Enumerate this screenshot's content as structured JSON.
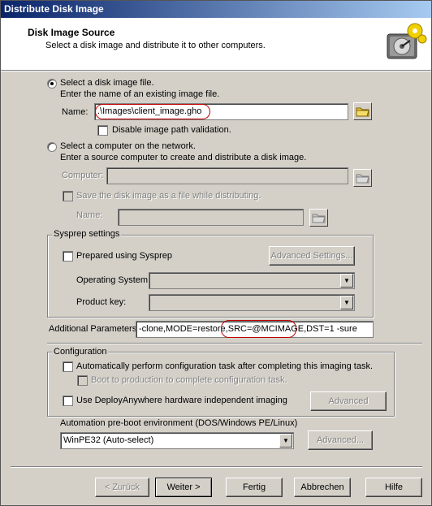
{
  "window": {
    "title": "Distribute Disk Image"
  },
  "header": {
    "title": "Disk Image Source",
    "subtitle": "Select a disk image and distribute it to other computers."
  },
  "image_file_option": {
    "label": "Select a disk image file.",
    "desc": "Enter the name of an existing image file.",
    "selected": true,
    "name_label": "Name:",
    "name_value": ".\\Images\\client_image.gho",
    "disable_validation_label": "Disable image path validation."
  },
  "computer_option": {
    "label": "Select a computer on the network.",
    "desc": "Enter a source computer to create and distribute a disk image.",
    "computer_label": "Computer:",
    "save_label": "Save the disk image as a file while distributing.",
    "name_label": "Name:"
  },
  "sysprep": {
    "group_title": "Sysprep settings",
    "prepared_label": "Prepared using Sysprep",
    "advanced_settings_label": "Advanced Settings...",
    "os_label": "Operating System:",
    "product_key_label": "Product key:"
  },
  "additional_params": {
    "label": "Additional Parameters:",
    "value": "-clone,MODE=restore,SRC=@MCIMAGE,DST=1 -sure"
  },
  "configuration": {
    "group_title": "Configuration",
    "auto_config_label": "Automatically perform configuration task after completing this imaging task.",
    "boot_prod_label": "Boot to production to complete configuration task.",
    "deploy_anywhere_label": "Use DeployAnywhere hardware independent imaging",
    "advanced_label": "Advanced"
  },
  "automation": {
    "label": "Automation pre-boot environment (DOS/Windows PE/Linux)",
    "selected": "WinPE32 (Auto-select)",
    "advanced_label": "Advanced..."
  },
  "footer": {
    "back_label": "< Zurück",
    "next_label": "Weiter >",
    "finish_label": "Fertig",
    "cancel_label": "Abbrechen",
    "help_label": "Hilfe"
  },
  "colors": {
    "annotation": "#c00000",
    "title_start": "#0a246a",
    "title_end": "#a6caf0"
  }
}
